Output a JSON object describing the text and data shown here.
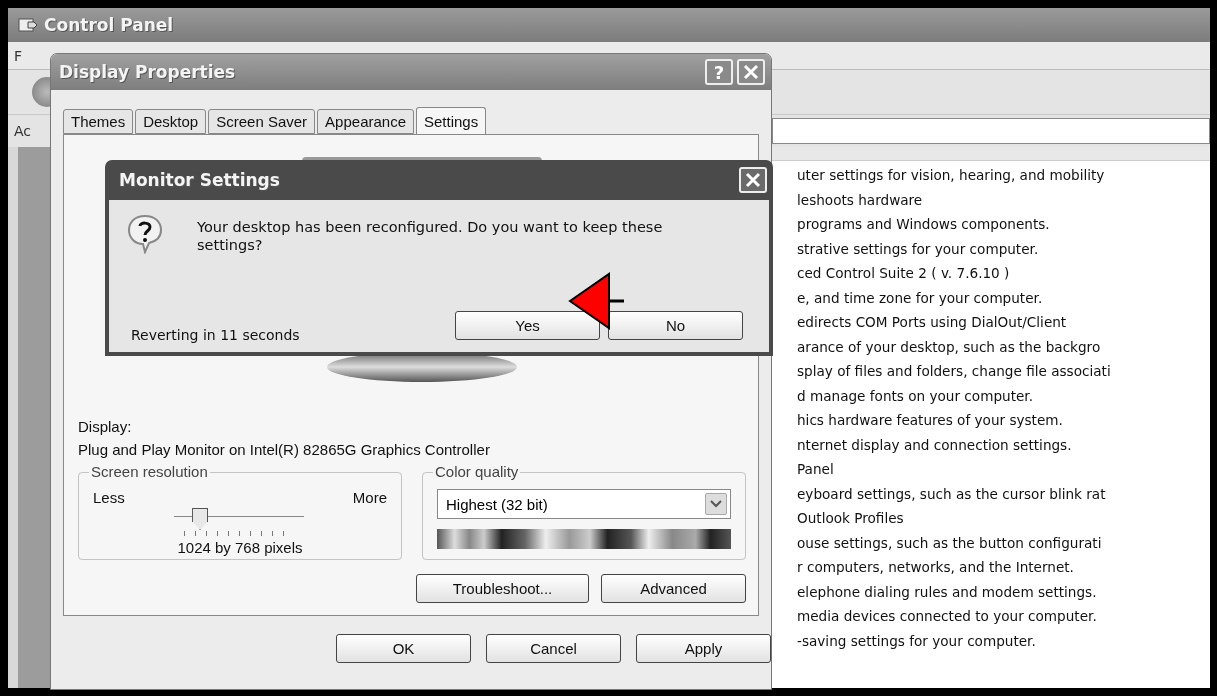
{
  "control_panel": {
    "title": "Control Panel",
    "menu_fragment": "F",
    "address_fragment": "Ac",
    "descriptions": [
      "uter settings for vision, hearing, and mobility",
      "leshoots hardware",
      "programs and Windows components.",
      "strative settings for your computer.",
      "ced Control Suite 2 ( v. 7.6.10 )",
      "e, and time zone for your computer.",
      "edirects COM Ports using DialOut/Client",
      "arance of your desktop, such as the backgro",
      "splay of files and folders, change file associati",
      "d manage fonts on your computer.",
      "hics hardware features of your system.",
      "nternet display and connection settings.",
      "Panel",
      "eyboard settings, such as the cursor blink rat",
      "Outlook Profiles",
      "ouse settings, such as the button configurati",
      "r computers, networks, and the Internet.",
      "elephone dialing rules and modem settings.",
      "media devices connected to your computer.",
      "-saving settings for your computer."
    ]
  },
  "display_properties": {
    "title": "Display Properties",
    "help": "?",
    "tabs": [
      {
        "label": "Themes",
        "selected": false
      },
      {
        "label": "Desktop",
        "selected": false
      },
      {
        "label": "Screen Saver",
        "selected": false
      },
      {
        "label": "Appearance",
        "selected": false
      },
      {
        "label": "Settings",
        "selected": true
      }
    ],
    "display_label": "Display:",
    "display_device": "Plug and Play Monitor on Intel(R) 82865G Graphics Controller",
    "screen_resolution": {
      "legend": "Screen resolution",
      "min_label": "Less",
      "max_label": "More",
      "level": 0.15,
      "value": "1024 by 768 pixels"
    },
    "color_quality": {
      "legend": "Color quality",
      "value": "Highest (32 bit)"
    },
    "panel_buttons": [
      "Troubleshoot...",
      "Advanced"
    ],
    "buttons": [
      "OK",
      "Cancel",
      "Apply"
    ]
  },
  "monitor_settings": {
    "title": "Monitor Settings",
    "message": "Your desktop has been reconfigured.  Do you want to keep these settings?",
    "countdown": "Reverting in 11 seconds",
    "buttons": [
      "Yes",
      "No"
    ]
  }
}
